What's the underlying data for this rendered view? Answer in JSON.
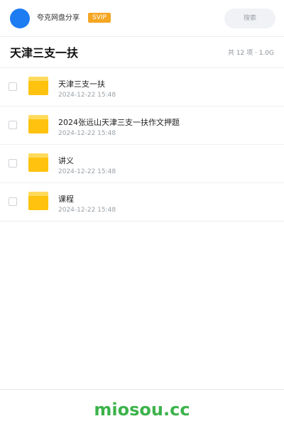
{
  "header": {
    "app_name": "夸克网盘分享",
    "badge": "SVIP",
    "search_placeholder": "搜索",
    "colors": {
      "avatar": "#1e7cf2",
      "badge": "#f5a623"
    }
  },
  "folder": {
    "title": "天津三支一扶",
    "summary": "共 12 项 · 1.0G"
  },
  "items": [
    {
      "name": "天津三支一扶",
      "date": "2024-12-22 15:48",
      "icon": "folder-icon"
    },
    {
      "name": "2024张远山天津三支一扶作文押题",
      "date": "2024-12-22 15:48",
      "icon": "folder-icon"
    },
    {
      "name": "讲义",
      "date": "2024-12-22 15:48",
      "icon": "folder-icon"
    },
    {
      "name": "课程",
      "date": "2024-12-22 15:48",
      "icon": "folder-icon"
    }
  ],
  "footer": {
    "brand": "miosou.cc",
    "brand_color": "#3cb34b"
  }
}
